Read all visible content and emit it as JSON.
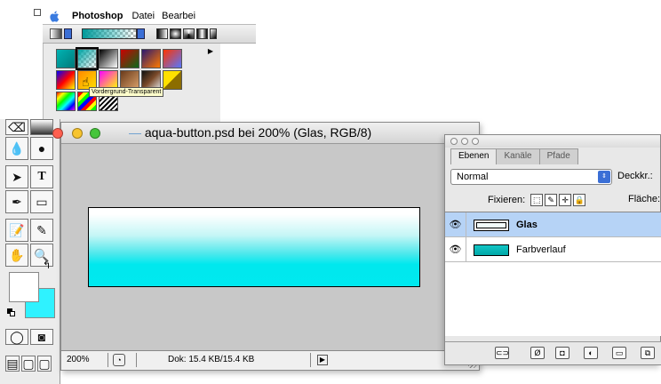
{
  "menubar": {
    "app_name": "Photoshop",
    "items": [
      "Datei",
      "Bearbei"
    ]
  },
  "options_bar": {
    "tool": "gradient",
    "gradient_preview": "Vordergrund-Transparent"
  },
  "gradient_picker": {
    "tooltip": "Vordergrund-Transparent",
    "presets_count": 15
  },
  "document": {
    "title_file": "aqua-button.psd",
    "title_rest": " bei 200% (Glas, RGB/8)",
    "zoom": "200%",
    "doc_info": "Dok: 15.4 KB/15.4 KB"
  },
  "layers_panel": {
    "tabs": [
      "Ebenen",
      "Kanäle",
      "Pfade"
    ],
    "active_tab": "Ebenen",
    "blend_mode": "Normal",
    "opacity_label": "Deckkr.:",
    "lock_label": "Fixieren:",
    "fill_label": "Fläche:",
    "layers": [
      {
        "name": "Glas",
        "selected": true,
        "visible": true
      },
      {
        "name": "Farbverlauf",
        "selected": false,
        "visible": true
      }
    ]
  },
  "tools_palette": {
    "foreground_color": "#ffffff",
    "background_color": "#2ff2ff"
  },
  "colors": {
    "traffic_red": "#ff5f4f",
    "traffic_yellow": "#f7c42e",
    "traffic_green": "#45c53a",
    "selection_blue": "#b6d3f6",
    "accent": "#3b6fd6"
  }
}
